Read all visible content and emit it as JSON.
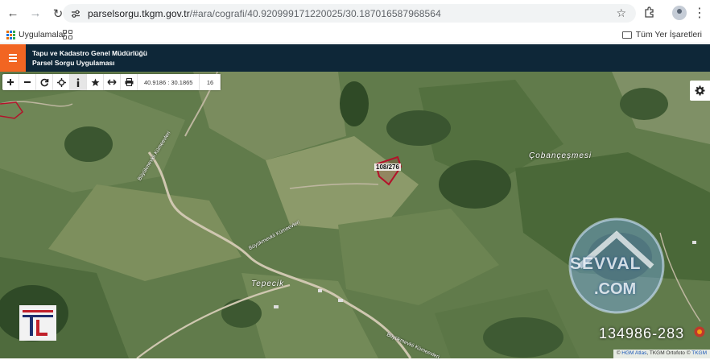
{
  "browser": {
    "url_host": "parselsorgu.tkgm.gov.tr",
    "url_path": "/#ara/cografi/40.920999171220025/30.187016587968564"
  },
  "bookmarks": {
    "apps_label": "Uygulamalar",
    "all_bookmarks_label": "Tüm Yer İşaretleri"
  },
  "app": {
    "title_line1": "Tapu ve Kadastro Genel Müdürlüğü",
    "title_line2": "Parsel Sorgu Uygulaması",
    "brand_color": "#0e2738",
    "accent_color": "#f26522"
  },
  "toolbar": {
    "buttons": [
      "zoom-in",
      "zoom-out",
      "refresh",
      "locate",
      "info",
      "favorite",
      "measure",
      "print"
    ],
    "coordinates": "40.9186 : 30.1865",
    "zoom_level": "16"
  },
  "map": {
    "parcel_label": "108/276",
    "parcel_color": "#b3122a",
    "place_labels": [
      "Çobançeşmesi",
      "Tepecik"
    ],
    "road_labels": [
      "Büyükmevkii Kümeevleri",
      "Büyükmevkii Kümeevleri",
      "Büyükmevkii Kümeevleri"
    ],
    "watermark_line1": "SEVVAL",
    "watermark_line2": ".COM",
    "ad_number": "134986-283",
    "corner_logo_letters": "TL",
    "attribution": {
      "hgm": "HGM Atlas",
      "middle": ", TKGM Ortofoto ©",
      "tkgm": "TKGM"
    }
  }
}
